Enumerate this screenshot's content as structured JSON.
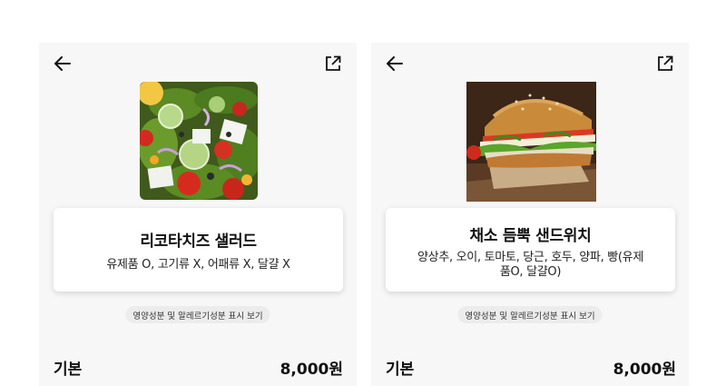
{
  "items": [
    {
      "name": "리코타치즈 샐러드",
      "description": "유제품 O, 고기류 X, 어패류 X, 달걀 X",
      "nutrition_button": "영양성분 및 알레르기성분 표시 보기",
      "option_label": "기본",
      "price": "8,000원",
      "image": "salad-photo"
    },
    {
      "name": "채소 듬뿍 샌드위치",
      "description": "양상추, 오이, 토마토, 당근, 호두, 양파, 빵(유제품O, 달걀O)",
      "nutrition_button": "영양성분 및 알레르기성분 표시 보기",
      "option_label": "기본",
      "price": "8,000원",
      "image": "sandwich-photo"
    }
  ],
  "icons": {
    "back": "arrow-left-icon",
    "share": "external-link-icon"
  },
  "colors": {
    "panel_bg": "#f7f7f7",
    "card_bg": "#ffffff",
    "chip_bg": "#ececec",
    "text": "#111111"
  }
}
